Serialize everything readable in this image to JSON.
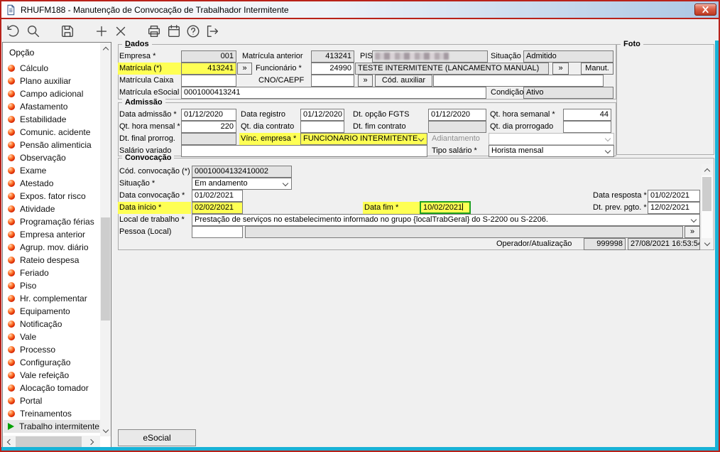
{
  "colors": {
    "frame": "#b8221a",
    "edge": "#19b2d6",
    "highlight": "#feff54",
    "focus": "#1fa11f",
    "play": "#00a000"
  },
  "window": {
    "title": "RHUFM188 - Manutenção de Convocação de Trabalhador Intermitente"
  },
  "toolbar": {
    "buttons": [
      "undo",
      "search",
      "save",
      "add",
      "delete",
      "print",
      "schedule",
      "help",
      "exit"
    ]
  },
  "sidebar": {
    "header": "Opção",
    "items": [
      {
        "label": "Cálculo"
      },
      {
        "label": "Plano auxiliar"
      },
      {
        "label": "Campo adicional"
      },
      {
        "label": "Afastamento"
      },
      {
        "label": "Estabilidade"
      },
      {
        "label": "Comunic. acidente"
      },
      {
        "label": "Pensão alimenticia"
      },
      {
        "label": "Observação"
      },
      {
        "label": "Exame"
      },
      {
        "label": "Atestado"
      },
      {
        "label": "Expos. fator risco"
      },
      {
        "label": "Atividade"
      },
      {
        "label": "Programação férias"
      },
      {
        "label": "Empresa anterior"
      },
      {
        "label": "Agrup. mov. diário"
      },
      {
        "label": "Rateio despesa"
      },
      {
        "label": "Feriado"
      },
      {
        "label": "Piso"
      },
      {
        "label": "Hr. complementar"
      },
      {
        "label": "Equipamento"
      },
      {
        "label": "Notificação"
      },
      {
        "label": "Vale"
      },
      {
        "label": "Processo"
      },
      {
        "label": "Configuração"
      },
      {
        "label": "Vale refeição"
      },
      {
        "label": "Alocação tomador"
      },
      {
        "label": "Portal"
      },
      {
        "label": "Treinamentos"
      },
      {
        "label": "Trabalho intermitente",
        "icon": "play",
        "selected": true
      }
    ]
  },
  "dados": {
    "legend": "Dados",
    "empresa": {
      "label": "Empresa *",
      "value": "001"
    },
    "matricula": {
      "label": "Matrícula (*)",
      "value": "413241"
    },
    "matricula_caixa": {
      "label": "Matrícula Caixa",
      "value": ""
    },
    "matricula_esocial": {
      "label": "Matrícula eSocial",
      "value": "0001000413241"
    },
    "matricula_anterior": {
      "label": "Matrícula anterior",
      "value": "413241"
    },
    "funcionario": {
      "label": "Funcionário *",
      "value": "24990",
      "nome": "TESTE INTERMITENTE (LANCAMENTO MANUAL)",
      "lookup": "»",
      "manut_button": "Manut. ..."
    },
    "cno_caepf": {
      "label": "CNO/CAEPF",
      "value": "",
      "lookup": "»",
      "aux_button": "Cód. auxiliar",
      "aux_value": ""
    },
    "pis": {
      "label": "PIS",
      "value_masked": true
    },
    "situacao": {
      "label": "Situação *",
      "value": "Admitido"
    },
    "condicao": {
      "label": "Condição",
      "value": "Ativo"
    }
  },
  "admissao": {
    "legend": "Admissão",
    "data_admissao": {
      "label": "Data admissão *",
      "value": "01/12/2020"
    },
    "data_registro": {
      "label": "Data registro",
      "value": "01/12/2020"
    },
    "dt_opcao_fgts": {
      "label": "Dt. opção FGTS",
      "value": "01/12/2020"
    },
    "qt_hora_semanal": {
      "label": "Qt. hora semanal *",
      "value": "44"
    },
    "qt_hora_mensal": {
      "label": "Qt. hora mensal *",
      "value": "220"
    },
    "qt_dia_contrato": {
      "label": "Qt. dia contrato",
      "value": ""
    },
    "dt_fim_contrato": {
      "label": "Dt. fim contrato",
      "value": ""
    },
    "qt_dia_prorrogado": {
      "label": "Qt. dia prorrogado",
      "value": ""
    },
    "dt_final_prorrog": {
      "label": "Dt. final prorrog.",
      "value": ""
    },
    "vinc_empresa": {
      "label": "Vínc. empresa *",
      "value": "FUNCIONARIO INTERMITENTE"
    },
    "adiantamento": {
      "label": "Adiantamento",
      "value": ""
    },
    "salario_variado": {
      "label": "Salário variado",
      "value": ""
    },
    "tipo_salario": {
      "label": "Tipo salário *",
      "value": "Horista mensal"
    }
  },
  "convocacao": {
    "legend": "Convocação",
    "cod_convocacao": {
      "label": "Cód. convocação (*)",
      "value": "00010004132410002"
    },
    "situacao": {
      "label": "Situação *",
      "value": "Em andamento"
    },
    "data_convocacao": {
      "label": "Data convocação *",
      "value": "01/02/2021"
    },
    "data_resposta": {
      "label": "Data resposta *",
      "value": "01/02/2021"
    },
    "data_inicio": {
      "label": "Data início *",
      "value": "02/02/2021"
    },
    "data_fim": {
      "label": "Data fim *",
      "value": "10/02/2021"
    },
    "dt_prev_pgto": {
      "label": "Dt. prev. pgto. *",
      "value": "12/02/2021"
    },
    "local_trabalho": {
      "label": "Local de trabalho *",
      "value": "Prestação de serviços no estabelecimento informado no grupo {localTrabGeral} do S-2200 ou S-2206."
    },
    "pessoa_local": {
      "label": "Pessoa (Local)",
      "value": "",
      "descricao": "",
      "lookup": "»"
    },
    "operador": {
      "label": "Operador/Atualização",
      "value": "999998",
      "datetime": "27/08/2021 16:53:54"
    }
  },
  "foto": {
    "legend": "Foto"
  },
  "footer": {
    "esocial_button": "eSocial"
  }
}
